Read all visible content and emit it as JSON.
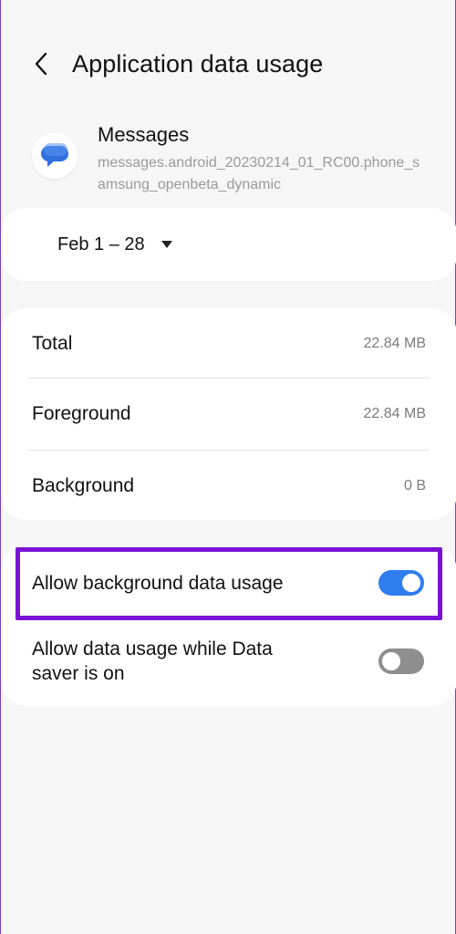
{
  "header": {
    "title": "Application data usage"
  },
  "app": {
    "name": "Messages",
    "package": "messages.android_20230214_01_RC00.phone_samsung_openbeta_dynamic",
    "icon": "chat-bubble-icon",
    "icon_color": "#2f6fe0"
  },
  "date_range": {
    "label": "Feb 1 – 28"
  },
  "usage": {
    "rows": [
      {
        "label": "Total",
        "value": "22.84 MB"
      },
      {
        "label": "Foreground",
        "value": "22.84 MB"
      },
      {
        "label": "Background",
        "value": "0 B"
      }
    ]
  },
  "toggles": [
    {
      "label": "Allow background data usage",
      "state": "on"
    },
    {
      "label": "Allow data usage while Data saver is on",
      "state": "off"
    }
  ],
  "colors": {
    "switch_on": "#2f7dee",
    "switch_off": "#8e8e8e",
    "highlight": "#7a12d6"
  }
}
